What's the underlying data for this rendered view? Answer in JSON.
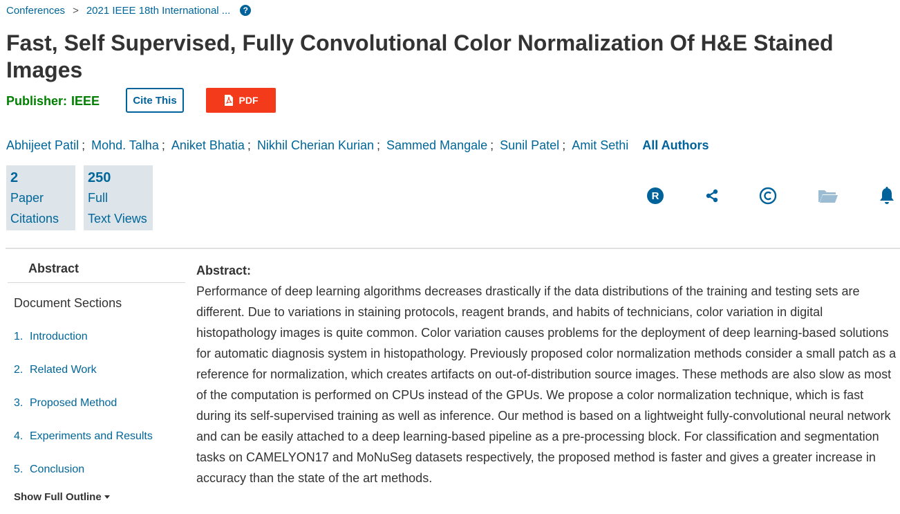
{
  "breadcrumb": {
    "items": [
      "Conferences",
      "2021 IEEE 18th International ..."
    ],
    "separator": ">",
    "help_icon": "?"
  },
  "article": {
    "title": "Fast, Self Supervised, Fully Convolutional Color Normalization Of H&E Stained Images",
    "publisher_label": "Publisher:",
    "publisher_value": "IEEE"
  },
  "actions": {
    "cite_label": "Cite This",
    "pdf_label": "PDF"
  },
  "authors": {
    "list": [
      "Abhijeet Patil",
      "Mohd. Talha",
      "Aniket Bhatia",
      "Nikhil Cherian Kurian",
      "Sammed Mangale",
      "Sunil Patel",
      "Amit Sethi"
    ],
    "separator": ";",
    "all_label": "All Authors"
  },
  "metrics": [
    {
      "value": "2",
      "line1": "Paper",
      "line2": "Citations"
    },
    {
      "value": "250",
      "line1": "Full",
      "line2": "Text Views"
    }
  ],
  "toolbar_icons": [
    "rights-icon",
    "share-icon",
    "copyright-icon",
    "folder-icon",
    "alert-bell-icon"
  ],
  "colors": {
    "link": "#006699",
    "publisher": "#008000",
    "pdf_button": "#f33a1a",
    "metric_bg": "#dde5ea",
    "icon_blue": "#00629b",
    "icon_disabled": "#9bbcd3"
  },
  "sidebar": {
    "tab_label": "Abstract",
    "sections_heading": "Document Sections",
    "sections": [
      {
        "num": "1.",
        "label": "Introduction"
      },
      {
        "num": "2.",
        "label": "Related Work"
      },
      {
        "num": "3.",
        "label": "Proposed Method"
      },
      {
        "num": "4.",
        "label": "Experiments and Results"
      },
      {
        "num": "5.",
        "label": "Conclusion"
      }
    ],
    "outline_label": "Show Full Outline"
  },
  "abstract": {
    "heading": "Abstract:",
    "text": "Performance of deep learning algorithms decreases drastically if the data distributions of the training and testing sets are different. Due to variations in staining protocols, reagent brands, and habits of technicians, color variation in digital histopathology images is quite common. Color variation causes problems for the deployment of deep learning-based solutions for automatic diagnosis system in histopathology. Previously proposed color normalization methods consider a small patch as a reference for normalization, which creates artifacts on out-of-distribution source images. These methods are also slow as most of the computation is performed on CPUs instead of the GPUs. We propose a color normalization technique, which is fast during its self-supervised training as well as inference. Our method is based on a lightweight fully-convolutional neural network and can be easily attached to a deep learning-based pipeline as a pre-processing block. For classification and segmentation tasks on CAMELYON17 and MoNuSeg datasets respectively, the proposed method is faster and gives a greater increase in accuracy than the state of the art methods."
  }
}
